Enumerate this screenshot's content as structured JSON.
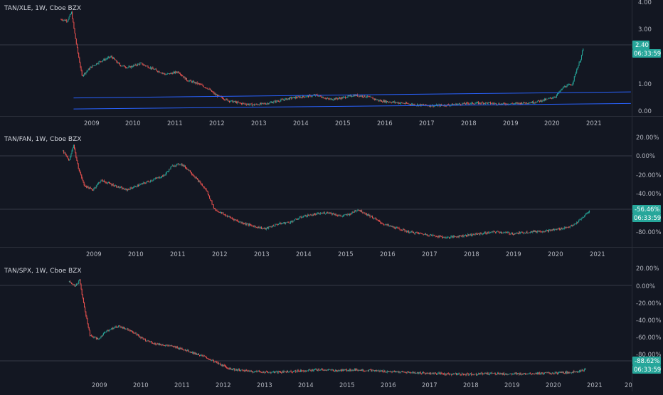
{
  "colors": {
    "background": "#131722",
    "grid": "#1e222d",
    "up": "#26a69a",
    "down": "#ef5350",
    "trendline": "#2962ff",
    "tag": "#26a69a",
    "text": "#b2b5be"
  },
  "chart_data": [
    {
      "type": "candlestick",
      "title": "TAN/XLE, 1W, Cboe BZX",
      "x_tick_labels": [
        "2009",
        "2010",
        "2011",
        "2012",
        "2013",
        "2014",
        "2015",
        "2016",
        "2017",
        "2018",
        "2019",
        "2020",
        "2021"
      ],
      "y_tick_labels": [
        "4.00",
        "3.00",
        "1.00",
        "0.00"
      ],
      "ylim": [
        0,
        4
      ],
      "last_value_label": "2.40",
      "countdown_label": "06:33:59",
      "last_value": 2.4,
      "series": [
        {
          "name": "TAN/XLE",
          "x": [
            2008.3,
            2008.45,
            2008.55,
            2008.65,
            2008.8,
            2009.0,
            2009.2,
            2009.35,
            2009.5,
            2009.7,
            2009.9,
            2010.2,
            2010.5,
            2010.8,
            2011.1,
            2011.3,
            2011.6,
            2011.8,
            2012.0,
            2012.3,
            2012.6,
            2012.9,
            2013.2,
            2013.5,
            2013.8,
            2014.1,
            2014.4,
            2014.7,
            2015.0,
            2015.3,
            2015.6,
            2015.9,
            2016.2,
            2016.5,
            2016.8,
            2017.2,
            2017.6,
            2018.0,
            2018.4,
            2018.8,
            2019.2,
            2019.6,
            2019.9,
            2020.1,
            2020.3,
            2020.5,
            2020.6,
            2020.7,
            2020.78
          ],
          "values": [
            3.35,
            3.3,
            3.6,
            2.6,
            1.3,
            1.6,
            1.8,
            1.9,
            2.0,
            1.7,
            1.6,
            1.75,
            1.55,
            1.35,
            1.45,
            1.15,
            1.0,
            0.85,
            0.6,
            0.4,
            0.3,
            0.25,
            0.3,
            0.4,
            0.5,
            0.55,
            0.6,
            0.45,
            0.5,
            0.6,
            0.55,
            0.4,
            0.35,
            0.3,
            0.25,
            0.22,
            0.25,
            0.3,
            0.32,
            0.28,
            0.3,
            0.35,
            0.45,
            0.55,
            0.9,
            1.0,
            1.5,
            1.9,
            2.4
          ]
        },
        {
          "name": "upper-trendline",
          "x": [
            2008.6,
            2021.9
          ],
          "values": [
            0.5,
            0.72
          ]
        },
        {
          "name": "lower-trendline",
          "x": [
            2008.6,
            2021.9
          ],
          "values": [
            0.1,
            0.3
          ]
        }
      ]
    },
    {
      "type": "candlestick",
      "title": "TAN/FAN, 1W, Cboe BZX",
      "x_tick_labels": [
        "2009",
        "2010",
        "2011",
        "2012",
        "2013",
        "2014",
        "2015",
        "2016",
        "2017",
        "2018",
        "2019",
        "2020",
        "2021"
      ],
      "y_tick_labels": [
        "20.00%",
        "0.00%",
        "-20.00%",
        "-40.00%",
        "-80.00%"
      ],
      "ylim": [
        -90,
        20
      ],
      "last_value_label": "-56.46%",
      "countdown_label": "06:33:59",
      "last_value": -56.46,
      "series": [
        {
          "name": "TAN/FAN",
          "x": [
            2008.3,
            2008.45,
            2008.55,
            2008.65,
            2008.8,
            2009.0,
            2009.2,
            2009.5,
            2009.8,
            2010.1,
            2010.4,
            2010.7,
            2010.9,
            2011.1,
            2011.3,
            2011.5,
            2011.7,
            2011.9,
            2012.2,
            2012.5,
            2012.8,
            2013.1,
            2013.4,
            2013.7,
            2014.0,
            2014.3,
            2014.6,
            2014.9,
            2015.1,
            2015.3,
            2015.6,
            2015.9,
            2016.2,
            2016.5,
            2016.8,
            2017.1,
            2017.4,
            2017.8,
            2018.2,
            2018.6,
            2019.0,
            2019.4,
            2019.8,
            2020.1,
            2020.4,
            2020.6,
            2020.8
          ],
          "values": [
            5,
            -5,
            12,
            -10,
            -30,
            -35,
            -25,
            -30,
            -35,
            -30,
            -25,
            -20,
            -10,
            -8,
            -15,
            -25,
            -35,
            -55,
            -62,
            -68,
            -72,
            -75,
            -70,
            -68,
            -62,
            -60,
            -58,
            -62,
            -60,
            -55,
            -62,
            -70,
            -74,
            -78,
            -80,
            -82,
            -84,
            -82,
            -80,
            -78,
            -80,
            -78,
            -77,
            -75,
            -72,
            -65,
            -56.46
          ]
        }
      ]
    },
    {
      "type": "candlestick",
      "title": "TAN/SPX, 1W, Cboe BZX",
      "x_tick_labels": [
        "2009",
        "2010",
        "2011",
        "2012",
        "2013",
        "2014",
        "2015",
        "2016",
        "2017",
        "2018",
        "2019",
        "2020",
        "2021",
        "20"
      ],
      "y_tick_labels": [
        "20.00%",
        "0.00%",
        "-20.00%",
        "-40.00%",
        "-60.00%",
        "-80.00%"
      ],
      "ylim": [
        -95,
        25
      ],
      "last_value_label": "-88.62%",
      "countdown_label": "06:33:59",
      "last_value": -88.62,
      "series": [
        {
          "name": "TAN/SPX",
          "x": [
            2008.3,
            2008.45,
            2008.55,
            2008.65,
            2008.8,
            2009.0,
            2009.2,
            2009.5,
            2009.8,
            2010.1,
            2010.4,
            2010.7,
            2011.0,
            2011.3,
            2011.6,
            2011.9,
            2012.2,
            2012.5,
            2012.8,
            2013.2,
            2013.6,
            2014.0,
            2014.4,
            2014.8,
            2015.2,
            2015.6,
            2016.0,
            2016.5,
            2017.0,
            2017.5,
            2018.0,
            2018.5,
            2019.0,
            2019.5,
            2020.0,
            2020.4,
            2020.7,
            2020.8
          ],
          "values": [
            10,
            5,
            12,
            -15,
            -50,
            -55,
            -45,
            -40,
            -45,
            -55,
            -60,
            -62,
            -65,
            -70,
            -75,
            -82,
            -88,
            -90,
            -91,
            -92,
            -91,
            -90,
            -89,
            -90,
            -89,
            -90,
            -91,
            -92,
            -93,
            -94,
            -94,
            -93,
            -94,
            -93,
            -93,
            -92,
            -90,
            -88.62
          ]
        }
      ]
    }
  ]
}
